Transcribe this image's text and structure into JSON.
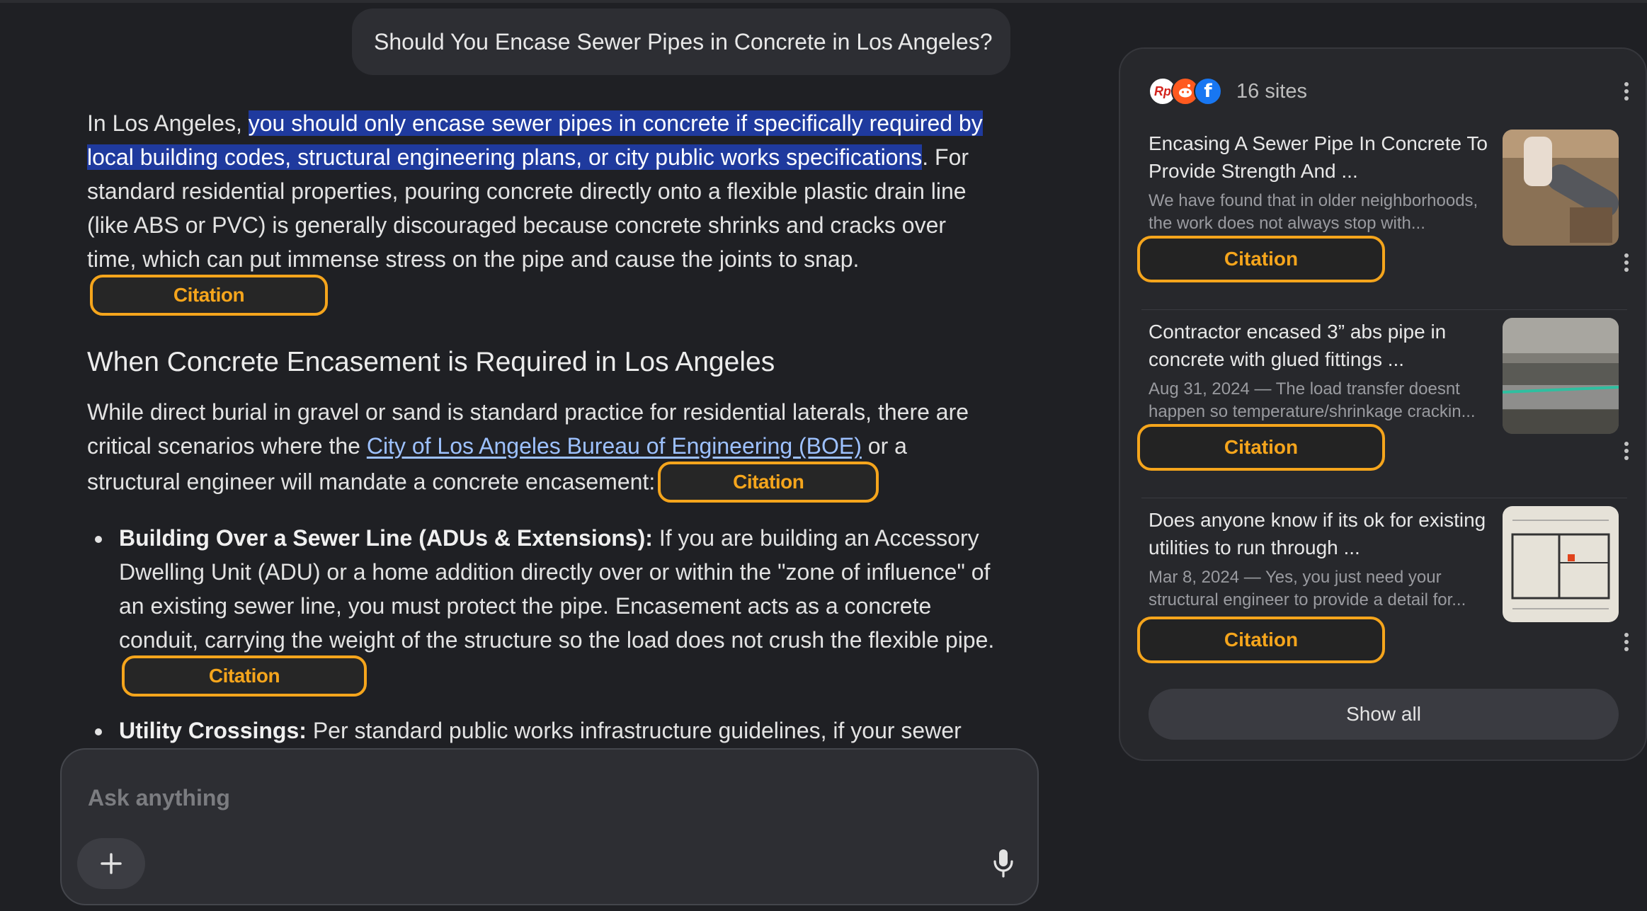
{
  "query": "Should You Encase Sewer Pipes in Concrete in Los Angeles?",
  "answer": {
    "intro_lead": "In Los Angeles, ",
    "intro_highlight": "you should only encase sewer pipes in concrete if specifically required by local building codes, structural engineering plans, or city public works specifications",
    "intro_rest": ". For standard residential properties, pouring concrete directly onto a flexible plastic drain line (like ABS or PVC) is generally discouraged because concrete shrinks and cracks over time, which can put immense stress on the pipe and cause the joints to snap.",
    "citation_label": "Citation",
    "heading": "When Concrete Encasement is Required in Los Angeles",
    "para2_lead": "While direct burial in gravel or sand is standard practice for residential laterals, there are critical scenarios where the ",
    "para2_link": "City of Los Angeles Bureau of Engineering (BOE)",
    "para2_rest": " or a structural engineer will mandate a concrete encasement:",
    "bullets": [
      {
        "title": "Building Over a Sewer Line (ADUs & Extensions):",
        "text": " If you are building an Accessory Dwelling Unit (ADU) or a home addition directly over or within the \"zone of influence\" of an existing sewer line, you must protect the pipe. Encasement acts as a concrete conduit, carrying the weight of the structure so the load does not crush the flexible pipe."
      },
      {
        "title": "Utility Crossings:",
        "text": " Per standard public works infrastructure guidelines, if your sewer"
      }
    ]
  },
  "ask_bar": {
    "placeholder": "Ask anything"
  },
  "sources": {
    "count_label": "16 sites",
    "cards": [
      {
        "title": "Encasing A Sewer Pipe In Concrete To Provide Strength And ...",
        "snippet": "We have found that in older neighborhoods, the work does not always stop with...",
        "citation": "Citation"
      },
      {
        "title": "Contractor encased 3” abs pipe in concrete with glued fittings ...",
        "snippet": "Aug 31, 2024 — The load transfer doesnt happen so temperature/shrinkage crackin...",
        "citation": "Citation"
      },
      {
        "title": "Does anyone know if its ok for existing utilities to run through ...",
        "snippet": "Mar 8, 2024 — Yes, you just need your structural engineer to provide a detail for...",
        "citation": "Citation"
      }
    ],
    "show_all": "Show all"
  },
  "colors": {
    "background": "#1f2024",
    "highlight": "#1f3a9e",
    "citation_accent": "#f5a51c",
    "link": "#9dc1ff"
  }
}
